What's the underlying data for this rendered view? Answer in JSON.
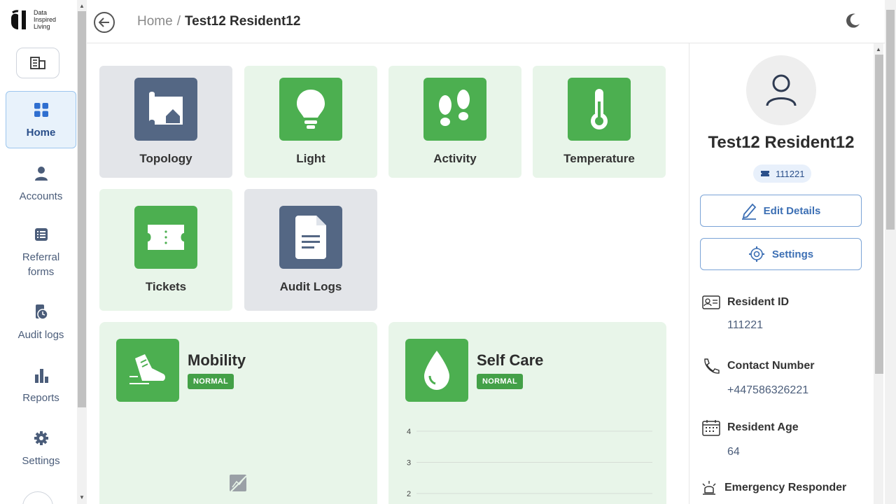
{
  "brand": {
    "line1": "Data",
    "line2": "Inspired",
    "line3": "Living"
  },
  "breadcrumb": {
    "home": "Home",
    "separator": "/",
    "current": "Test12 Resident12"
  },
  "nav": [
    {
      "label": "Home",
      "icon": "grid-icon"
    },
    {
      "label": "Accounts",
      "icon": "user-icon"
    },
    {
      "label": "Referral forms",
      "icon": "list-icon"
    },
    {
      "label": "Audit logs",
      "icon": "clock-icon"
    },
    {
      "label": "Reports",
      "icon": "bar-chart-icon"
    },
    {
      "label": "Settings",
      "icon": "gear-icon"
    }
  ],
  "tiles": [
    {
      "label": "Topology",
      "icon": "map-house-icon"
    },
    {
      "label": "Light",
      "icon": "bulb-icon"
    },
    {
      "label": "Activity",
      "icon": "footprints-icon"
    },
    {
      "label": "Temperature",
      "icon": "thermometer-icon"
    },
    {
      "label": "Tickets",
      "icon": "ticket-icon"
    },
    {
      "label": "Audit Logs",
      "icon": "document-icon"
    }
  ],
  "cards": {
    "mobility": {
      "title": "Mobility",
      "status": "NORMAL"
    },
    "selfcare": {
      "title": "Self Care",
      "status": "NORMAL"
    }
  },
  "chart_data": {
    "type": "line",
    "title": "",
    "y_ticks": [
      4,
      3,
      2
    ],
    "series": []
  },
  "resident": {
    "name": "Test12 Resident12",
    "id_chip": "111221",
    "edit_label": "Edit Details",
    "settings_label": "Settings",
    "id_label": "Resident ID",
    "id_value": "111221",
    "contact_label": "Contact Number",
    "contact_value": "+447586326221",
    "age_label": "Resident Age",
    "age_value": "64",
    "emergency_label": "Emergency Responder"
  },
  "colors": {
    "accent_green": "#4caf50",
    "slate": "#546784",
    "link_blue": "#3c6fb4"
  }
}
